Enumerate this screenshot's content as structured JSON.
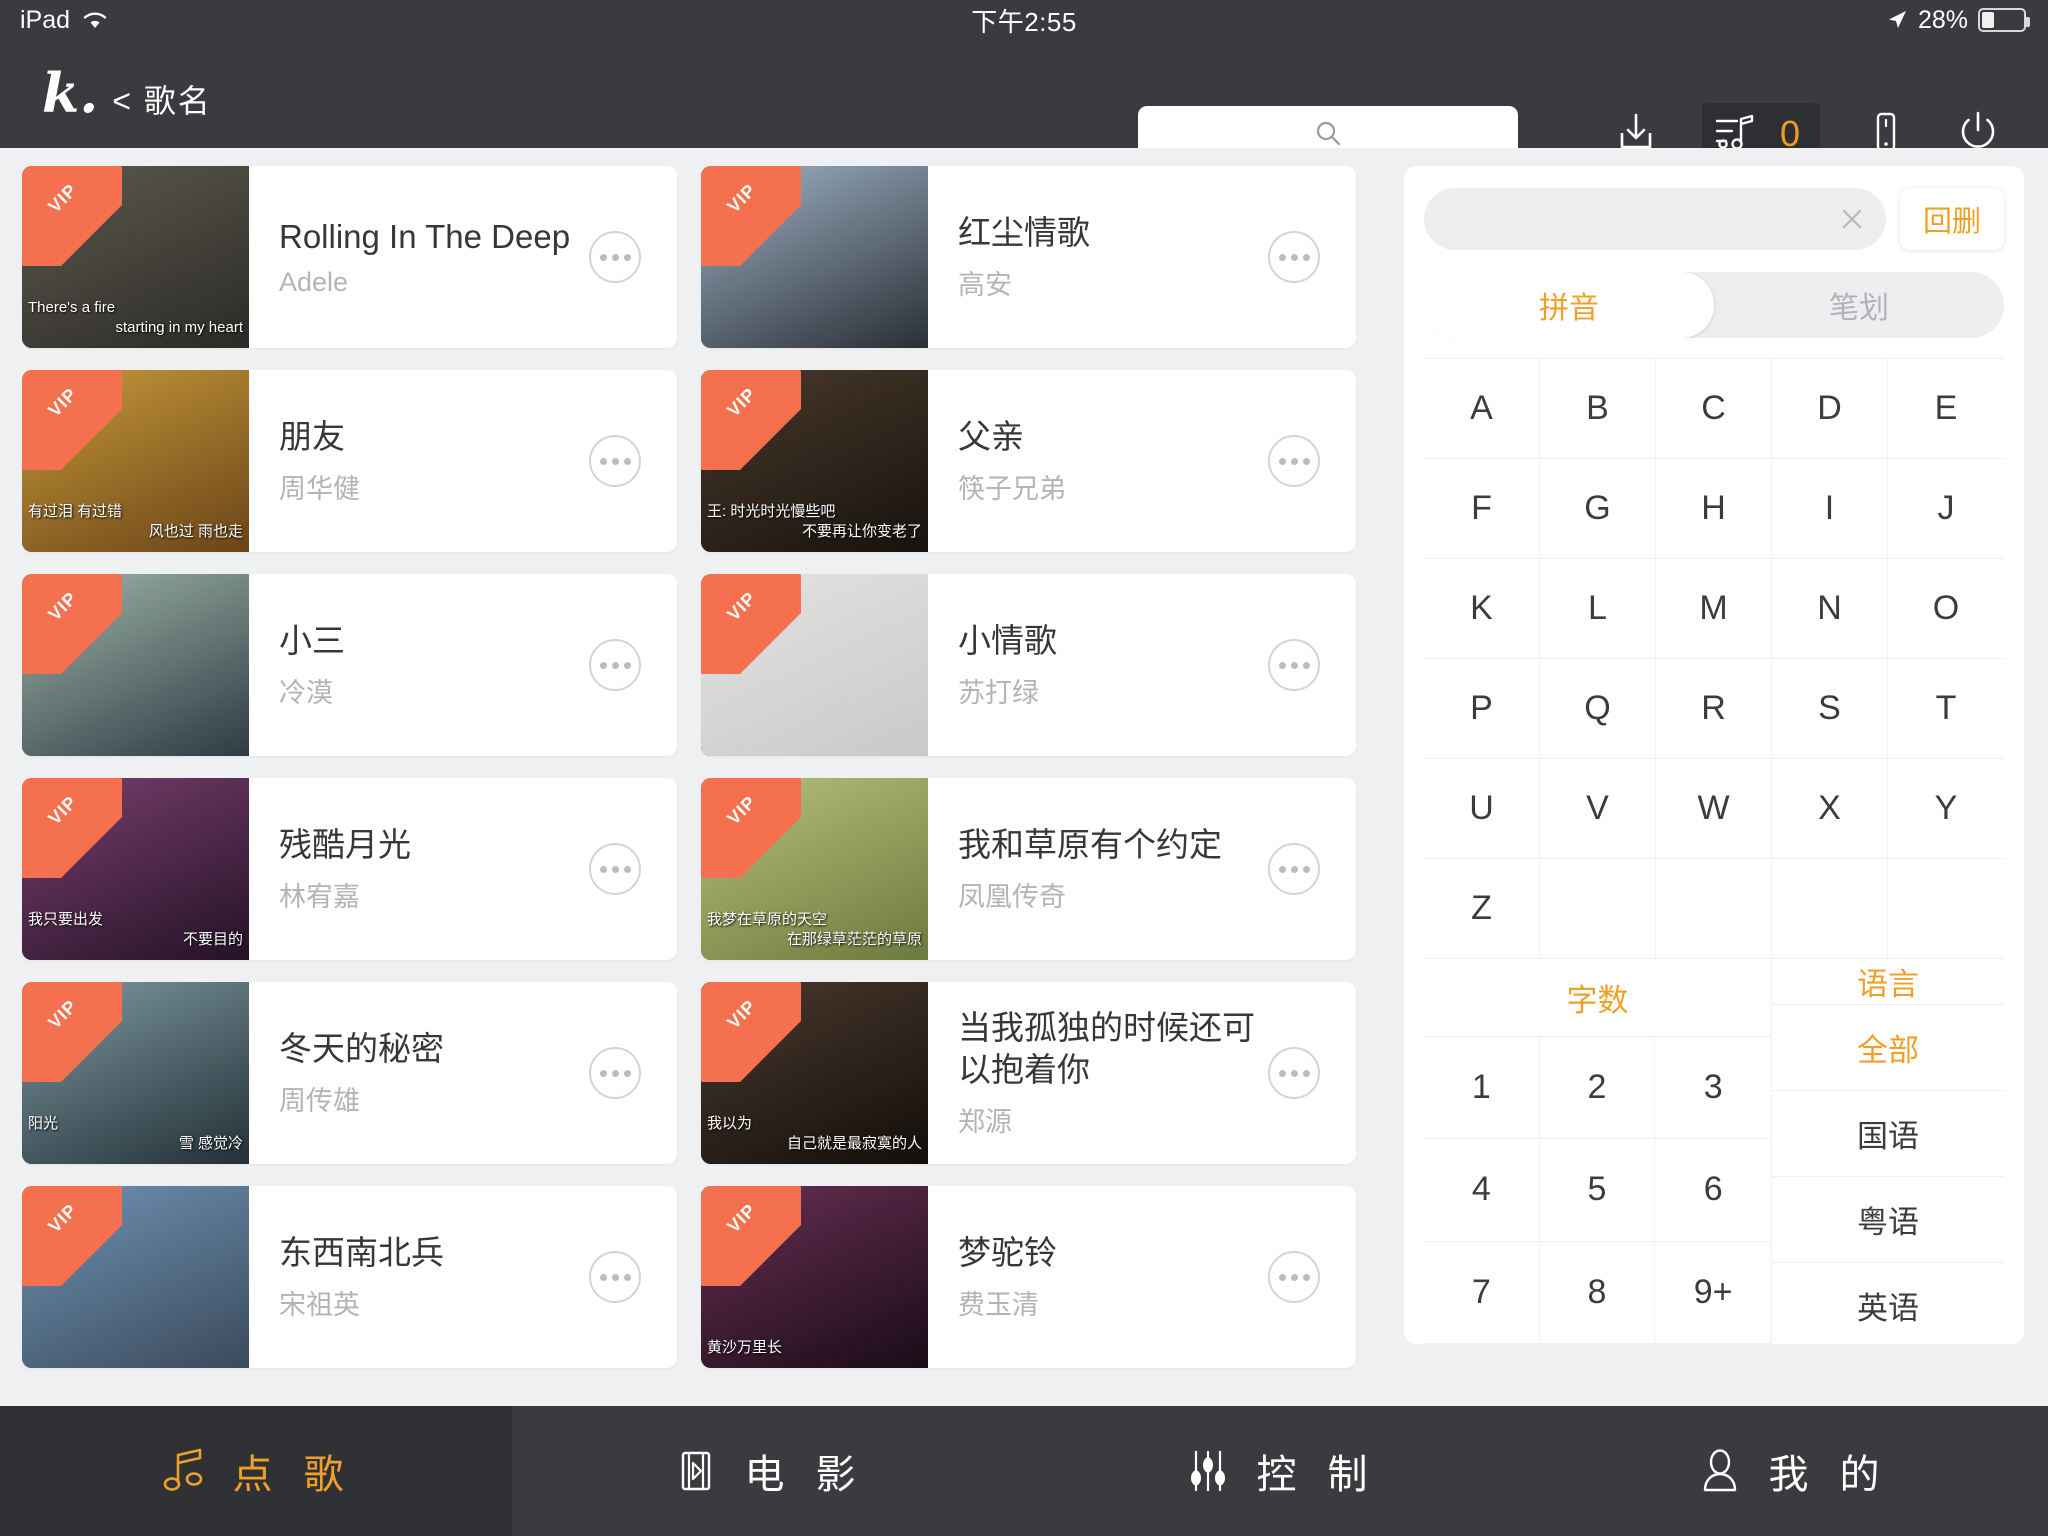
{
  "status_bar": {
    "device": "iPad",
    "wifi_icon": "wifi-icon",
    "time": "下午2:55",
    "location_icon": "location-arrow-icon",
    "battery_percent": "28%",
    "battery_level": 28
  },
  "header": {
    "logo": "k.",
    "back_label": "< 歌名",
    "search": {
      "value": "",
      "placeholder": "",
      "icon": "search-icon"
    },
    "tools": [
      {
        "name": "download-button",
        "icon": "download-icon"
      },
      {
        "name": "queue-button",
        "icon": "playlist-music-icon",
        "count": "0"
      },
      {
        "name": "remote-button",
        "icon": "mobile-phone-icon"
      },
      {
        "name": "power-button",
        "icon": "power-icon"
      }
    ]
  },
  "songs": [
    {
      "title": "Rolling In The Deep",
      "artist": "Adele",
      "vip": "VIP",
      "sub1": "There's a fire",
      "sub2": "starting in my heart",
      "thumb_a": "#5d5a4e",
      "thumb_b": "#2b2a26"
    },
    {
      "title": "红尘情歌",
      "artist": "高安",
      "vip": "VIP",
      "sub1": "",
      "sub2": "",
      "thumb_a": "#9fb4c6",
      "thumb_b": "#2a2f36"
    },
    {
      "title": "朋友",
      "artist": "周华健",
      "vip": "VIP",
      "sub1": "有过泪 有过错",
      "sub2": "风也过 雨也走",
      "thumb_a": "#c79a3a",
      "thumb_b": "#6b4418"
    },
    {
      "title": "父亲",
      "artist": "筷子兄弟",
      "vip": "VIP",
      "sub1": "王: 时光时光慢些吧",
      "sub2": "不要再让你变老了",
      "thumb_a": "#4a3a2c",
      "thumb_b": "#17120d"
    },
    {
      "title": "小三",
      "artist": "冷漠",
      "vip": "VIP",
      "sub1": "",
      "sub2": "",
      "thumb_a": "#9fb6a8",
      "thumb_b": "#2f3b44"
    },
    {
      "title": "小情歌",
      "artist": "苏打绿",
      "vip": "VIP",
      "sub1": "",
      "sub2": "",
      "thumb_a": "#e3e3e1",
      "thumb_b": "#c9c9c7"
    },
    {
      "title": "残酷月光",
      "artist": "林宥嘉",
      "vip": "VIP",
      "sub1": "我只要出发",
      "sub2": "不要目的",
      "thumb_a": "#7a3f6e",
      "thumb_b": "#241226"
    },
    {
      "title": "我和草原有个约定",
      "artist": "凤凰传奇",
      "vip": "VIP",
      "sub1": "我梦在草原的天空",
      "sub2": "在那绿草茫茫的草原",
      "thumb_a": "#b8c07a",
      "thumb_b": "#6d7a3e"
    },
    {
      "title": "冬天的秘密",
      "artist": "周传雄",
      "vip": "VIP",
      "sub1": "阳光",
      "sub2": "雪 感觉冷",
      "thumb_a": "#7d9aa0",
      "thumb_b": "#233037"
    },
    {
      "title": "当我孤独的时候还可以抱着你",
      "artist": "郑源",
      "vip": "VIP",
      "sub1": "我以为",
      "sub2": "自己就是最寂寞的人",
      "thumb_a": "#4b3a2e",
      "thumb_b": "#120e0a"
    },
    {
      "title": "东西南北兵",
      "artist": "宋祖英",
      "vip": "VIP",
      "sub1": "",
      "sub2": "",
      "thumb_a": "#6f93b5",
      "thumb_b": "#3b4a5c"
    },
    {
      "title": "梦驼铃",
      "artist": "费玉清",
      "vip": "VIP",
      "sub1": "黄沙万里长",
      "sub2": "",
      "thumb_a": "#6a2f55",
      "thumb_b": "#190c16"
    }
  ],
  "keyboard": {
    "input_value": "",
    "input_placeholder": "",
    "clear_icon": "close-x-icon",
    "delete_label": "回删",
    "tabs": [
      {
        "label": "拼音",
        "active": true
      },
      {
        "label": "笔划",
        "active": false
      }
    ],
    "letters": [
      "A",
      "B",
      "C",
      "D",
      "E",
      "F",
      "G",
      "H",
      "I",
      "J",
      "K",
      "L",
      "M",
      "N",
      "O",
      "P",
      "Q",
      "R",
      "S",
      "T",
      "U",
      "V",
      "W",
      "X",
      "Y",
      "Z"
    ],
    "count_header": "字数",
    "numbers": [
      "1",
      "2",
      "3",
      "4",
      "5",
      "6",
      "7",
      "8",
      "9+"
    ],
    "language_header": "语言",
    "languages": [
      {
        "label": "全部",
        "active": true
      },
      {
        "label": "国语",
        "active": false
      },
      {
        "label": "粤语",
        "active": false
      },
      {
        "label": "英语",
        "active": false
      }
    ]
  },
  "bottom_nav": [
    {
      "label": "点 歌",
      "icon": "music-note-icon",
      "active": true
    },
    {
      "label": "电 影",
      "icon": "film-strip-icon",
      "active": false
    },
    {
      "label": "控 制",
      "icon": "sliders-icon",
      "active": false
    },
    {
      "label": "我 的",
      "icon": "person-icon",
      "active": false
    }
  ],
  "colors": {
    "accent": "#f0a028",
    "vip_ribbon": "#f4704f",
    "chrome": "#3a3b3f",
    "page_bg": "#eef0f2"
  }
}
